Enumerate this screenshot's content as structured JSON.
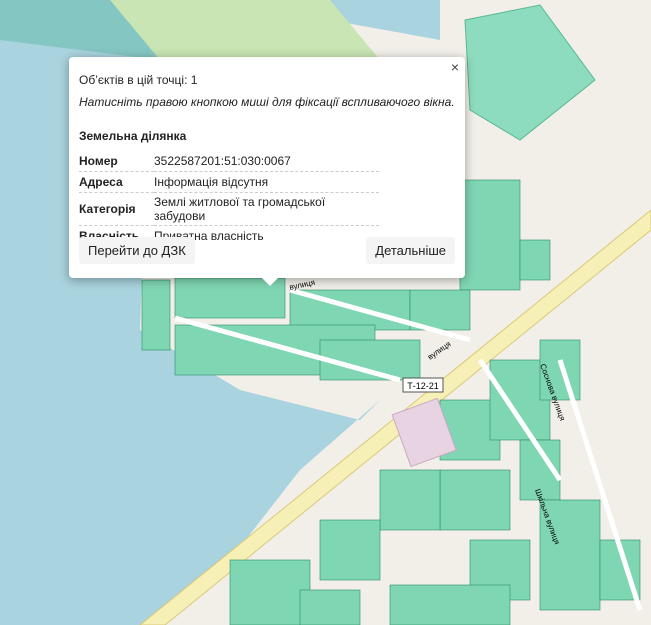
{
  "popup": {
    "close_label": "×",
    "objects_count_text": "Об’єктів в цій точці: 1",
    "hint_text": "Натисніть правою кнопкою миші для фіксації вспливаючого вікна.",
    "title": "Земельна ділянка",
    "rows": [
      {
        "key": "Номер",
        "value": "3522587201:51:030:0067"
      },
      {
        "key": "Адреса",
        "value": "Інформація відсутня"
      },
      {
        "key": "Категорія",
        "value": "Землі житлової та громадської забудови"
      },
      {
        "key": "Власність",
        "value": "Приватна власність"
      }
    ],
    "goto_button": "Перейти до ДЗК",
    "details_button": "Детальніше"
  },
  "map_labels": {
    "road_shield": "Т-12-21",
    "street_1": "вулиця",
    "street_2": "вулиця",
    "street_3": "Шкільна вулиця",
    "street_4": "Соснова вулиця"
  },
  "colors": {
    "water": "#a9d3de",
    "parcel_fill": "#7fd6b3",
    "parcel_stroke": "#2e8a66",
    "road": "#f6f0b6",
    "land": "#f2efe9"
  }
}
